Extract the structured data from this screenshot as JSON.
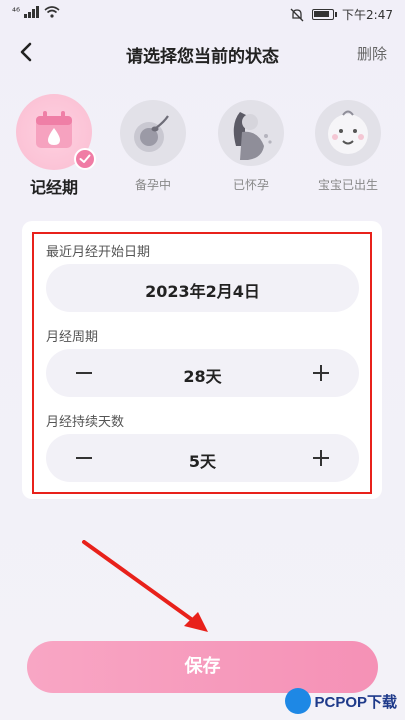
{
  "statusbar": {
    "signal": "⁴⁶",
    "time": "下午2:47"
  },
  "header": {
    "title": "请选择您当前的状态",
    "delete_label": "删除"
  },
  "states": [
    {
      "label": "记经期",
      "icon": "calendar-drop-icon",
      "active": true
    },
    {
      "label": "备孕中",
      "icon": "sperm-egg-icon",
      "active": false
    },
    {
      "label": "已怀孕",
      "icon": "pregnant-woman-icon",
      "active": false
    },
    {
      "label": "宝宝已出生",
      "icon": "baby-icon",
      "active": false
    }
  ],
  "form": {
    "start_date": {
      "label": "最近月经开始日期",
      "value": "2023年2月4日"
    },
    "cycle": {
      "label": "月经周期",
      "value": "28天"
    },
    "duration": {
      "label": "月经持续天数",
      "value": "5天"
    }
  },
  "save_label": "保存",
  "watermark": {
    "text": "PCPOP下载"
  },
  "colors": {
    "accent": "#f591b6",
    "annotation": "#e8211b"
  }
}
